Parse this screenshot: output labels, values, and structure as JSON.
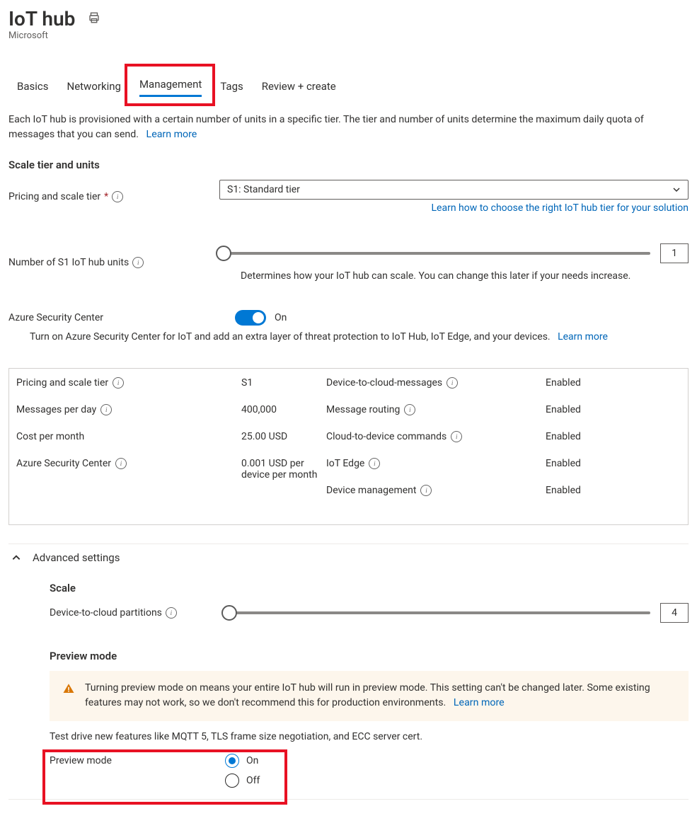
{
  "header": {
    "title": "IoT hub",
    "subtitle": "Microsoft"
  },
  "tabs": [
    {
      "label": "Basics",
      "active": false
    },
    {
      "label": "Networking",
      "active": false
    },
    {
      "label": "Management",
      "active": true
    },
    {
      "label": "Tags",
      "active": false
    },
    {
      "label": "Review + create",
      "active": false
    }
  ],
  "intro": {
    "text": "Each IoT hub is provisioned with a certain number of units in a specific tier. The tier and number of units determine the maximum daily quota of messages that you can send.",
    "learn_more": "Learn more"
  },
  "scale": {
    "heading": "Scale tier and units",
    "pricing_label": "Pricing and scale tier",
    "pricing_value": "S1: Standard tier",
    "pricing_help_link": "Learn how to choose the right IoT hub tier for your solution",
    "units_label": "Number of S1 IoT hub units",
    "units_value": "1",
    "units_helper": "Determines how your IoT hub can scale. You can change this later if your needs increase."
  },
  "security": {
    "label": "Azure Security Center",
    "state": "On",
    "desc": "Turn on Azure Security Center for IoT and add an extra layer of threat protection to IoT Hub, IoT Edge, and your devices.",
    "learn_more": "Learn more"
  },
  "summary": {
    "left": [
      {
        "label": "Pricing and scale tier",
        "value": "S1",
        "info": true
      },
      {
        "label": "Messages per day",
        "value": "400,000",
        "info": true
      },
      {
        "label": "Cost per month",
        "value": "25.00 USD",
        "info": false
      },
      {
        "label": "Azure Security Center",
        "value": "0.001 USD per device per month",
        "info": true
      }
    ],
    "right": [
      {
        "label": "Device-to-cloud-messages",
        "value": "Enabled"
      },
      {
        "label": "Message routing",
        "value": "Enabled"
      },
      {
        "label": "Cloud-to-device commands",
        "value": "Enabled"
      },
      {
        "label": "IoT Edge",
        "value": "Enabled"
      },
      {
        "label": "Device management",
        "value": "Enabled"
      }
    ]
  },
  "advanced": {
    "heading": "Advanced settings",
    "scale_heading": "Scale",
    "partitions_label": "Device-to-cloud partitions",
    "partitions_value": "4",
    "preview_heading": "Preview mode",
    "warning_text": "Turning preview mode on means your entire IoT hub will run in preview mode. This setting can't be changed later. Some existing features may not work, so we don't recommend this for production environments.",
    "warning_learn_more": "Learn more",
    "preview_desc": "Test drive new features like MQTT 5, TLS frame size negotiation, and ECC server cert.",
    "preview_label": "Preview mode",
    "radio_on": "On",
    "radio_off": "Off",
    "selected": "On"
  }
}
